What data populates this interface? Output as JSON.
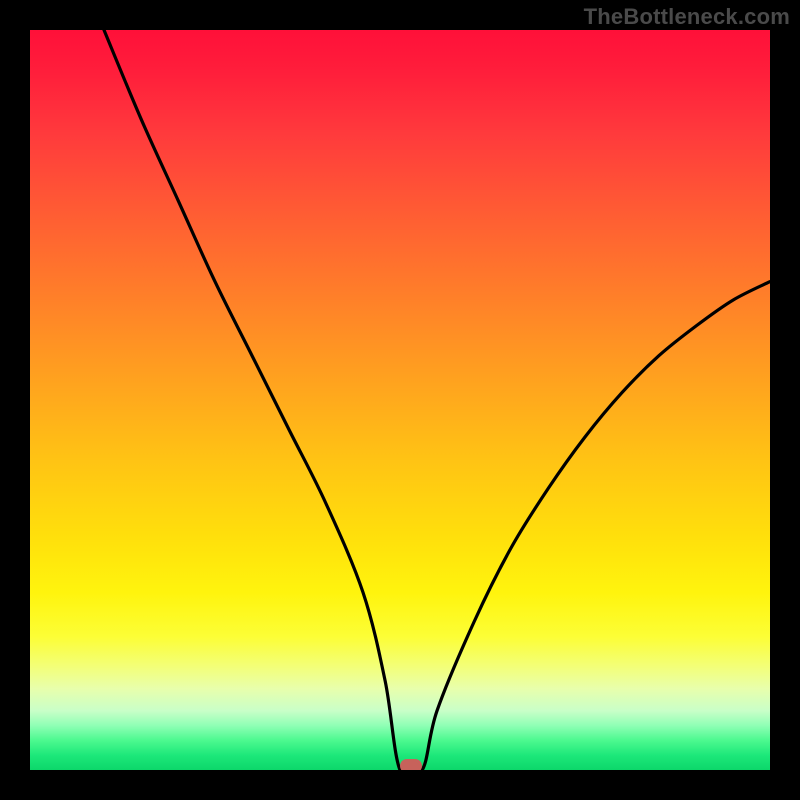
{
  "watermark": "TheBottleneck.com",
  "chart_data": {
    "type": "line",
    "title": "",
    "xlabel": "",
    "ylabel": "",
    "xlim": [
      0,
      100
    ],
    "ylim": [
      0,
      100
    ],
    "x": [
      10,
      15,
      20,
      25,
      30,
      35,
      40,
      45,
      48,
      50,
      53,
      55,
      60,
      65,
      70,
      75,
      80,
      85,
      90,
      95,
      100
    ],
    "values": [
      100,
      88,
      77,
      66,
      56,
      46,
      36,
      24,
      12,
      0,
      0,
      8,
      20,
      30,
      38,
      45,
      51,
      56,
      60,
      63.5,
      66
    ],
    "background_gradient": {
      "top_color": "#ff1039",
      "bottom_color": "#0cd76a"
    },
    "marker": {
      "x": 51.5,
      "y": 0,
      "color": "#c7625b"
    }
  }
}
